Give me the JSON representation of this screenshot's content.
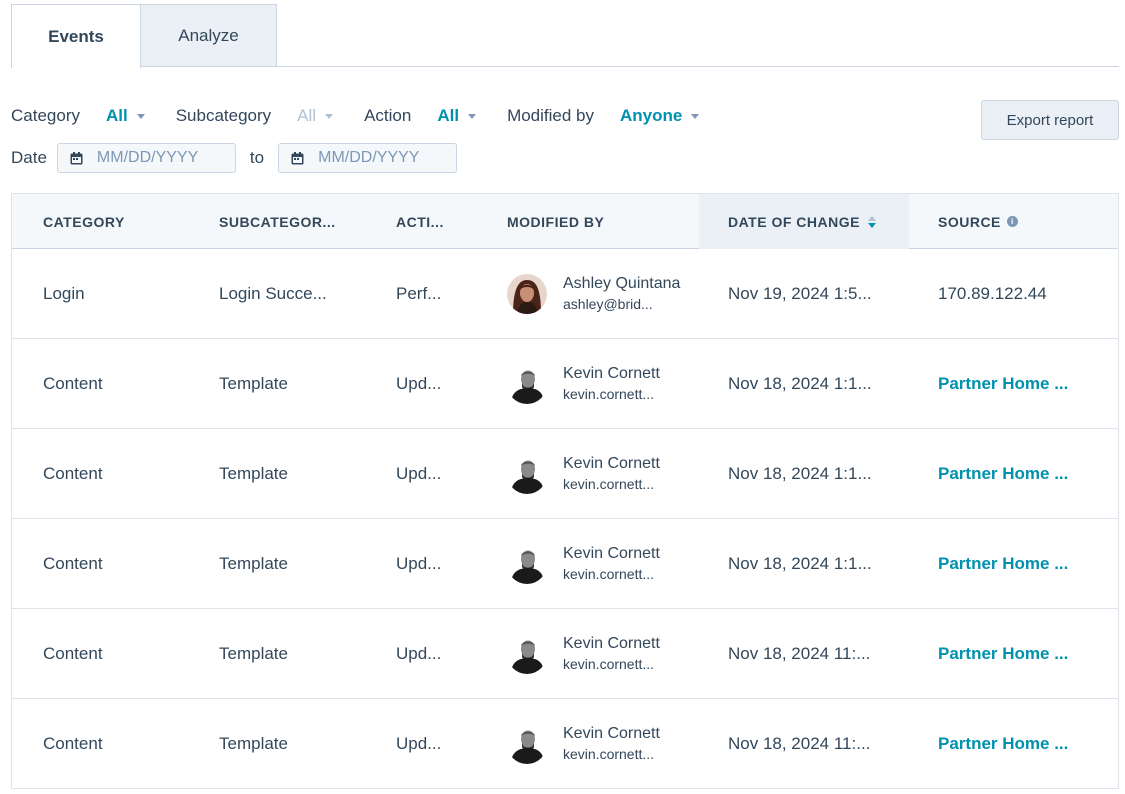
{
  "tabs": [
    {
      "label": "Events"
    },
    {
      "label": "Analyze"
    }
  ],
  "filters": {
    "category_label": "Category",
    "category_value": "All",
    "subcategory_label": "Subcategory",
    "subcategory_value": "All",
    "action_label": "Action",
    "action_value": "All",
    "modified_by_label": "Modified by",
    "modified_by_value": "Anyone",
    "date_label": "Date",
    "date_from_placeholder": "MM/DD/YYYY",
    "date_to_label": "to",
    "date_to_placeholder": "MM/DD/YYYY"
  },
  "export_button": "Export report",
  "table": {
    "headers": [
      "CATEGORY",
      "SUBCATEGOR...",
      "ACTI...",
      "MODIFIED BY",
      "DATE OF CHANGE",
      "SOURCE"
    ],
    "rows": [
      {
        "category": "Login",
        "subcategory": "Login Succe...",
        "action": "Perf...",
        "name": "Ashley Quintana",
        "email": "ashley@brid...",
        "date": "Nov 19, 2024 1:5...",
        "source": "170.89.122.44",
        "source_link": false
      },
      {
        "category": "Content",
        "subcategory": "Template",
        "action": "Upd...",
        "name": "Kevin Cornett",
        "email": "kevin.cornett...",
        "date": "Nov 18, 2024 1:1...",
        "source": "Partner Home ...",
        "source_link": true
      },
      {
        "category": "Content",
        "subcategory": "Template",
        "action": "Upd...",
        "name": "Kevin Cornett",
        "email": "kevin.cornett...",
        "date": "Nov 18, 2024 1:1...",
        "source": "Partner Home ...",
        "source_link": true
      },
      {
        "category": "Content",
        "subcategory": "Template",
        "action": "Upd...",
        "name": "Kevin Cornett",
        "email": "kevin.cornett...",
        "date": "Nov 18, 2024 1:1...",
        "source": "Partner Home ...",
        "source_link": true
      },
      {
        "category": "Content",
        "subcategory": "Template",
        "action": "Upd...",
        "name": "Kevin Cornett",
        "email": "kevin.cornett...",
        "date": "Nov 18, 2024 11:...",
        "source": "Partner Home ...",
        "source_link": true
      },
      {
        "category": "Content",
        "subcategory": "Template",
        "action": "Upd...",
        "name": "Kevin Cornett",
        "email": "kevin.cornett...",
        "date": "Nov 18, 2024 11:...",
        "source": "Partner Home ...",
        "source_link": true
      }
    ]
  },
  "colors": {
    "accent": "#0091ae",
    "text": "#33475b",
    "header_bg": "#f5f8fa",
    "border": "#cbd6e2"
  }
}
